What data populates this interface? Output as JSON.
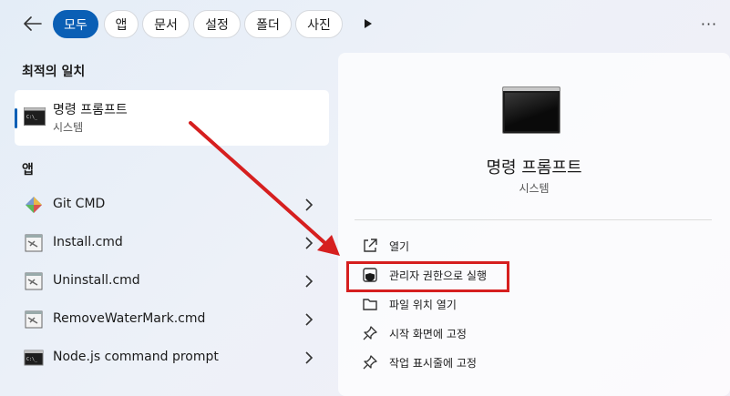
{
  "topbar": {
    "chips": [
      "모두",
      "앱",
      "문서",
      "설정",
      "폴더",
      "사진"
    ],
    "active_chip": "모두",
    "more_label": "···"
  },
  "best_match": {
    "title": "최적의 일치",
    "name": "명령 프롬프트",
    "sub": "시스템"
  },
  "apps": {
    "title": "앱",
    "items": [
      {
        "label": "Git CMD",
        "icon": "git-icon"
      },
      {
        "label": "Install.cmd",
        "icon": "cmd-file-icon"
      },
      {
        "label": "Uninstall.cmd",
        "icon": "cmd-file-icon"
      },
      {
        "label": "RemoveWaterMark.cmd",
        "icon": "cmd-file-icon"
      },
      {
        "label": "Node.js command prompt",
        "icon": "console-icon"
      }
    ]
  },
  "detail": {
    "name": "명령 프롬프트",
    "sub": "시스템",
    "actions": [
      {
        "label": "열기",
        "icon": "open-external-icon"
      },
      {
        "label": "관리자 권한으로 실행",
        "icon": "shield-icon"
      },
      {
        "label": "파일 위치 열기",
        "icon": "folder-icon"
      },
      {
        "label": "시작 화면에 고정",
        "icon": "pin-icon"
      },
      {
        "label": "작업 표시줄에 고정",
        "icon": "pin-icon"
      }
    ]
  },
  "colors": {
    "accent": "#0a5fb5",
    "annotation": "#d61f1f"
  }
}
